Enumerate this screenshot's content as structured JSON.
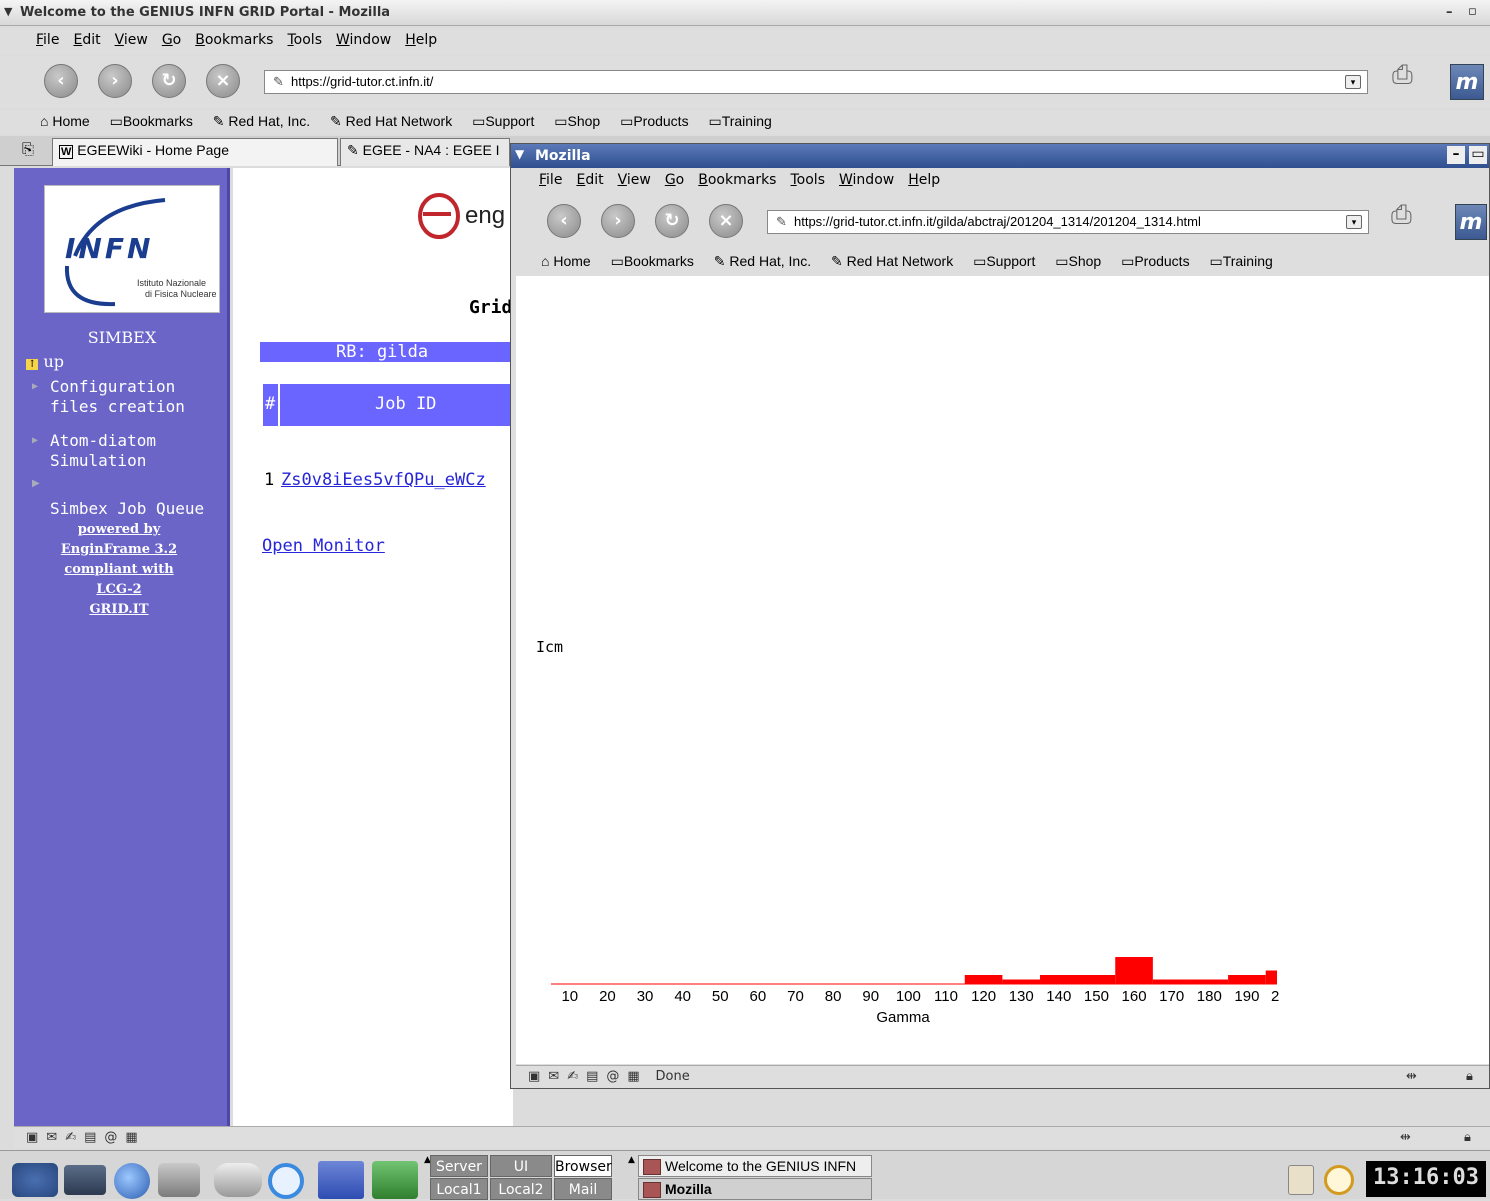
{
  "main_window": {
    "title": "Welcome to the GENIUS INFN GRID Portal - Mozilla",
    "menu": [
      "File",
      "Edit",
      "View",
      "Go",
      "Bookmarks",
      "Tools",
      "Window",
      "Help"
    ],
    "url": "https://grid-tutor.ct.infn.it/",
    "bookmarks": [
      "Home",
      "Bookmarks",
      "Red Hat, Inc.",
      "Red Hat Network",
      "Support",
      "Shop",
      "Products",
      "Training"
    ],
    "tabs": [
      "EGEEWiki - Home Page",
      "EGEE - NA4 : EGEE I"
    ]
  },
  "sidebar": {
    "logo_text": "INFN",
    "logo_sub1": "Istituto Nazionale",
    "logo_sub2": "di Fisica Nucleare",
    "section_title": "SIMBEX",
    "up_label": "up",
    "items": [
      {
        "line1": "Configuration",
        "line2": "files creation"
      },
      {
        "line1": "Atom-diatom",
        "line2": "Simulation"
      },
      {
        "line1": "Simbex Job Queue",
        "line2": ""
      }
    ],
    "powered": [
      "powered by",
      "EnginFrame 3.2",
      "compliant with",
      "LCG-2",
      "GRID.IT"
    ]
  },
  "content": {
    "logo_partial": "eng",
    "grid_partial": "Grid",
    "rb_label": "RB: gilda",
    "col_hash": "#",
    "col_jobid": "Job ID",
    "row_num": "1",
    "row_job": "Zs0v8iEes5vfQPu_eWCz",
    "open_monitor": "Open Monitor"
  },
  "popup": {
    "title": "Mozilla",
    "menu": [
      "File",
      "Edit",
      "View",
      "Go",
      "Bookmarks",
      "Tools",
      "Window",
      "Help"
    ],
    "url": "https://grid-tutor.ct.infn.it/gilda/abctraj/201204_1314/201204_1314.html",
    "bookmarks": [
      "Home",
      "Bookmarks",
      "Red Hat, Inc.",
      "Red Hat Network",
      "Support",
      "Shop",
      "Products",
      "Training"
    ],
    "status": "Done"
  },
  "chart_data": {
    "type": "bar",
    "ylabel": "Icm",
    "xlabel": "Gamma",
    "tick_labels": [
      "10",
      "20",
      "30",
      "40",
      "50",
      "60",
      "70",
      "80",
      "90",
      "100",
      "110",
      "120",
      "130",
      "140",
      "150",
      "160",
      "170",
      "180",
      "190",
      "2"
    ],
    "bars": [
      {
        "x0": 115,
        "x1": 125,
        "value": 1
      },
      {
        "x0": 125,
        "x1": 135,
        "value": 0.5
      },
      {
        "x0": 135,
        "x1": 155,
        "value": 1
      },
      {
        "x0": 155,
        "x1": 165,
        "value": 3
      },
      {
        "x0": 165,
        "x1": 175,
        "value": 0.5
      },
      {
        "x0": 175,
        "x1": 185,
        "value": 0.5
      },
      {
        "x0": 185,
        "x1": 195,
        "value": 1
      },
      {
        "x0": 195,
        "x1": 198,
        "value": 1.5
      }
    ],
    "xlim": [
      5,
      198
    ],
    "color": "#ff0000"
  },
  "taskbar": {
    "pager": [
      "Server",
      "UI",
      "Browser",
      "Local1",
      "Local2",
      "Mail"
    ],
    "active_pager": "Browser",
    "tasks": [
      "Welcome to the GENIUS INFN",
      "Mozilla"
    ],
    "clock": "13:16:03"
  }
}
